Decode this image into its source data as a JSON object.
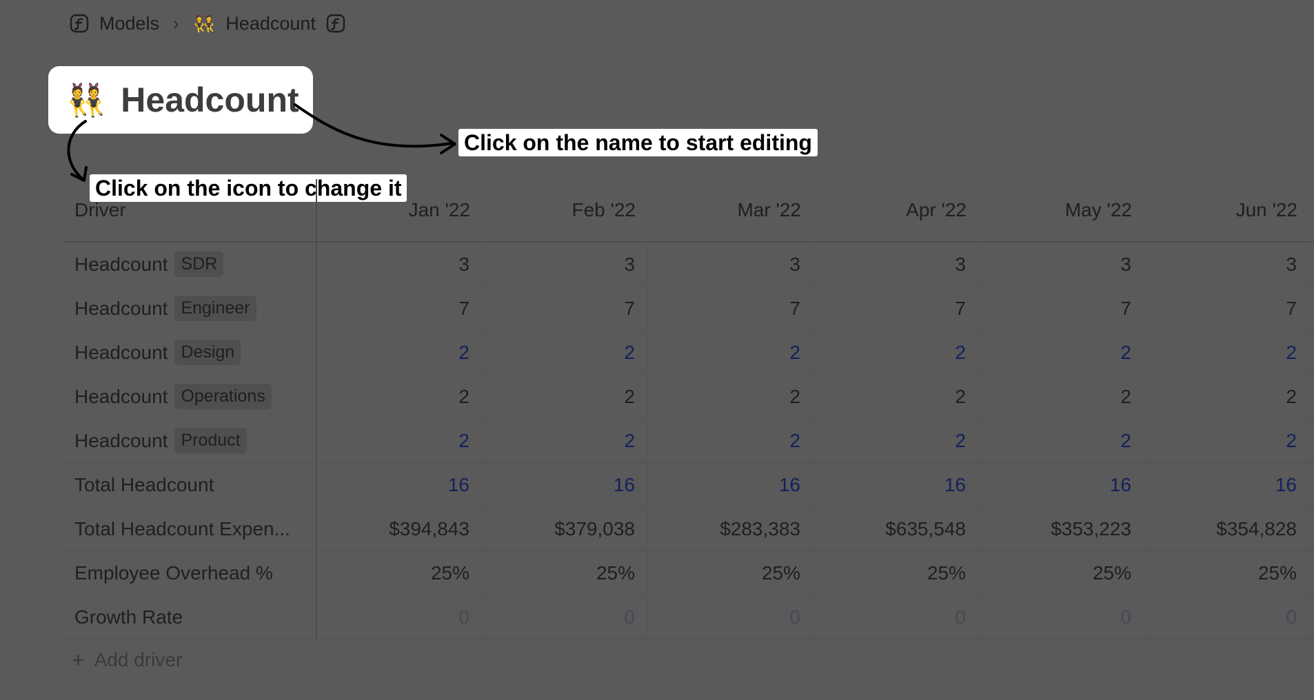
{
  "breadcrumb": {
    "models_label": "Models",
    "current_icon": "👯",
    "current_label": "Headcount",
    "separator": "›"
  },
  "header": {
    "icon": "👯",
    "title": "Headcount"
  },
  "callouts": {
    "name_hint": "Click on the name to start editing",
    "icon_hint": "Click on the icon to change it"
  },
  "table": {
    "driver_header": "Driver",
    "columns": [
      "Jan '22",
      "Feb '22",
      "Mar '22",
      "Apr '22",
      "May '22",
      "Jun '22"
    ],
    "rows": [
      {
        "name": "Headcount",
        "tag": "SDR",
        "values": [
          "3",
          "3",
          "3",
          "3",
          "3",
          "3"
        ]
      },
      {
        "name": "Headcount",
        "tag": "Engineer",
        "values": [
          "7",
          "7",
          "7",
          "7",
          "7",
          "7"
        ]
      },
      {
        "name": "Headcount",
        "tag": "Design",
        "values": [
          "2",
          "2",
          "2",
          "2",
          "2",
          "2"
        ]
      },
      {
        "name": "Headcount",
        "tag": "Operations",
        "values": [
          "2",
          "2",
          "2",
          "2",
          "2",
          "2"
        ]
      },
      {
        "name": "Headcount",
        "tag": "Product",
        "values": [
          "2",
          "2",
          "2",
          "2",
          "2",
          "2"
        ]
      },
      {
        "name": "Total Headcount",
        "values": [
          "16",
          "16",
          "16",
          "16",
          "16",
          "16"
        ]
      },
      {
        "name": "Total Headcount Expen...",
        "values": [
          "$394,843",
          "$379,038",
          "$283,383",
          "$635,548",
          "$353,223",
          "$354,828"
        ]
      },
      {
        "name": "Employee Overhead %",
        "values": [
          "25%",
          "25%",
          "25%",
          "25%",
          "25%",
          "25%"
        ]
      },
      {
        "name": "Growth Rate",
        "values": [
          "0",
          "0",
          "0",
          "0",
          "0",
          "0"
        ]
      }
    ]
  },
  "add_driver_label": "Add driver",
  "icons": {
    "model": "formula-f-icon",
    "chevron": "chevron-right-icon",
    "plus": "plus-icon"
  },
  "colors": {
    "background": "#5a5a5a",
    "formula_value": "#15205b",
    "muted_value": "#434a55"
  }
}
